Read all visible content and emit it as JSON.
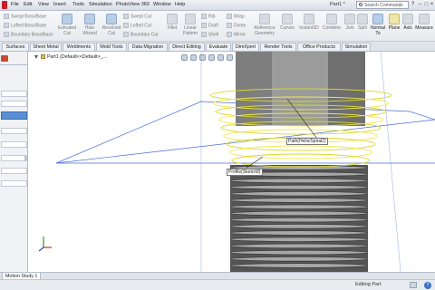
{
  "menubar": {
    "items": [
      "File",
      "Edit",
      "View",
      "Insert",
      "Tools",
      "Simulation",
      "PhotoView 360",
      "Window",
      "Help"
    ],
    "doc_title": "Part1 *",
    "search_placeholder": "Search Commands",
    "controls": [
      "?",
      "–",
      "□",
      "×"
    ]
  },
  "ribbon": {
    "small_items_col1": [
      "Swept Boss/Base",
      "Lofted Boss/Base",
      "Boundary Boss/Base"
    ],
    "big_items": [
      {
        "label": "Extruded\nCut",
        "icon": "extruded-cut-icon"
      },
      {
        "label": "Hole\nWizard",
        "icon": "hole-wizard-icon"
      },
      {
        "label": "Revolved\nCut",
        "icon": "revolved-cut-icon"
      }
    ],
    "small_items_col2": [
      "Swept Cut",
      "Lofted Cut",
      "Boundary Cut"
    ],
    "big_items2": [
      {
        "label": "Fillet",
        "icon": "fillet-icon"
      },
      {
        "label": "Linear\nPattern",
        "icon": "linear-pattern-icon"
      }
    ],
    "small_items_col3": [
      "Rib",
      "Draft",
      "Shell"
    ],
    "small_items_col4": [
      "Wrap",
      "Dome",
      "Mirror"
    ],
    "big_items3": [
      {
        "label": "Reference\nGeometry",
        "icon": "reference-geometry-icon"
      },
      {
        "label": "Curves",
        "icon": "curves-icon"
      },
      {
        "label": "Instant3D",
        "icon": "instant3d-icon"
      },
      {
        "label": "Combine",
        "icon": "combine-icon"
      },
      {
        "label": "Join",
        "icon": "join-icon"
      },
      {
        "label": "Split",
        "icon": "split-icon"
      },
      {
        "label": "Normal\nTo",
        "icon": "normal-to-icon"
      },
      {
        "label": "Plane",
        "icon": "plane-icon"
      },
      {
        "label": "Axis",
        "icon": "axis-icon"
      },
      {
        "label": "Measure",
        "icon": "measure-icon"
      }
    ]
  },
  "tabs": [
    "Surfaces",
    "Sheet Metal",
    "Weldments",
    "Mold Tools",
    "Data Migration",
    "Direct Editing",
    "Evaluate",
    "DimXpert",
    "Render Tools",
    "Office Products",
    "Simulation"
  ],
  "tree": {
    "root_label": "Part1  (Default<<Default>_..."
  },
  "viewport": {
    "path_label": "Path(Helix/Spiral2)",
    "profile_label": "Profile(Sketch8)"
  },
  "bottom_tab": "Motion Study 1",
  "status": {
    "text": "Editing Part"
  },
  "colors": {
    "helix": "#d8d82a",
    "helix_highlight": "#f0e850",
    "thread_dark": "#3c3c3c",
    "thread_light": "#a8a8a8",
    "blue_line": "#4a6fd8"
  }
}
